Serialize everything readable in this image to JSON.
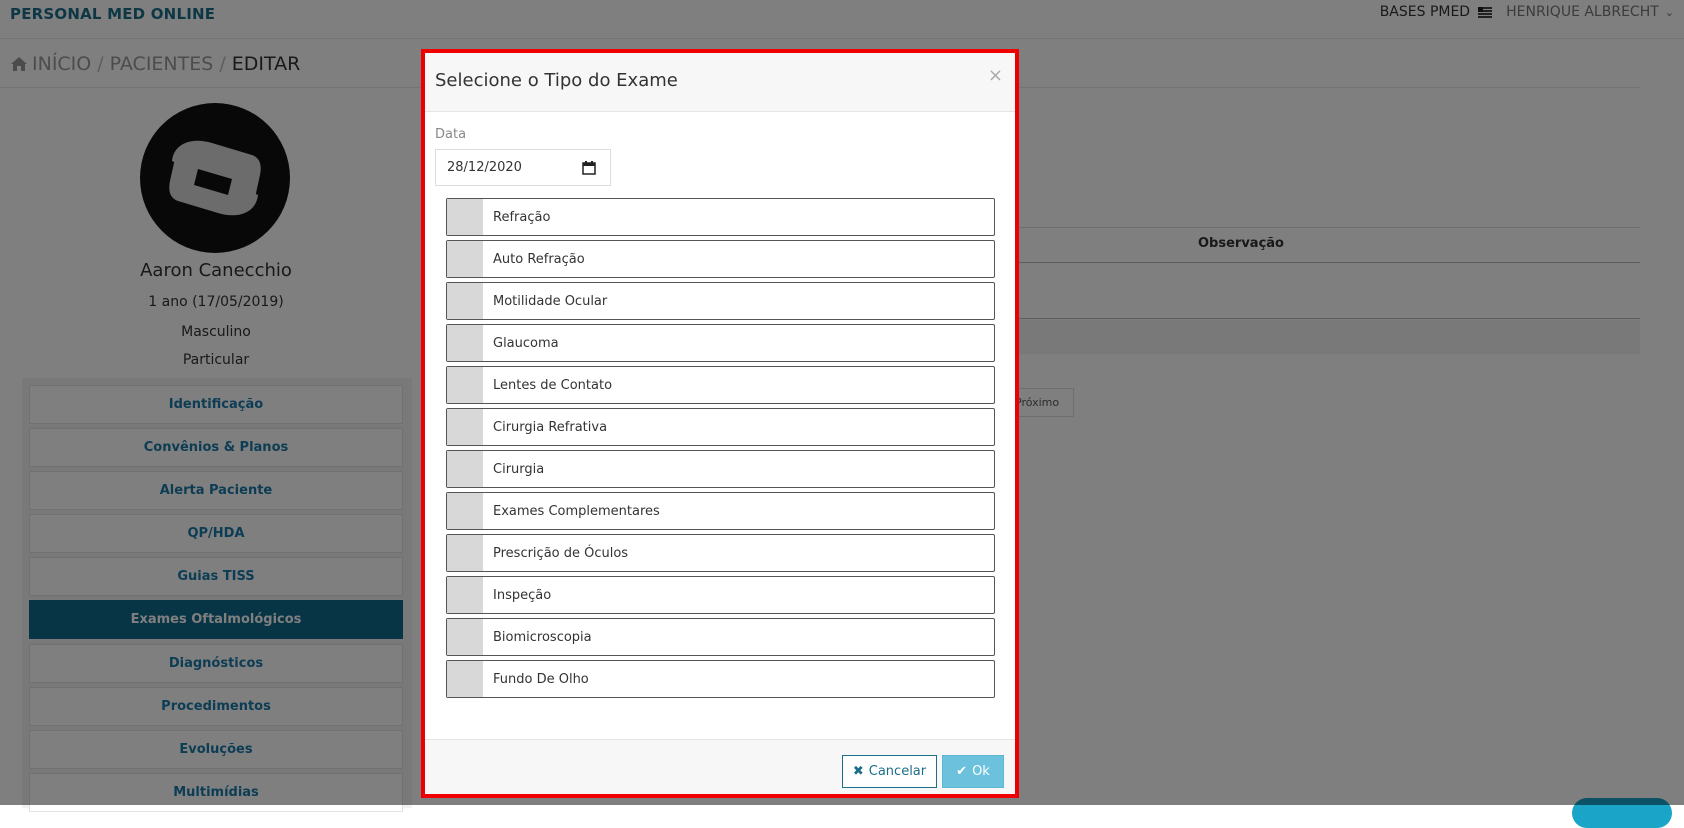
{
  "app": {
    "brand": "PERSONAL MED ONLINE",
    "bases_label": "BASES PMED",
    "user_name": "HENRIQUE ALBRECHT"
  },
  "breadcrumb": {
    "home": "INÍCIO",
    "sep": "/",
    "patients": "PACIENTES",
    "current": "EDITAR"
  },
  "patient": {
    "name": "Aaron Canecchio",
    "age": "1 ano (17/05/2019)",
    "gender": "Masculino",
    "plan": "Particular"
  },
  "sidebar": {
    "items": [
      {
        "label": "Identificação",
        "active": false
      },
      {
        "label": "Convênios & Planos",
        "active": false
      },
      {
        "label": "Alerta Paciente",
        "active": false
      },
      {
        "label": "QP/HDA",
        "active": false
      },
      {
        "label": "Guias TISS",
        "active": false
      },
      {
        "label": "Exames Oftalmológicos",
        "active": true
      },
      {
        "label": "Diagnósticos",
        "active": false
      },
      {
        "label": "Procedimentos",
        "active": false
      },
      {
        "label": "Evoluções",
        "active": false
      },
      {
        "label": "Multimídias",
        "active": false
      }
    ]
  },
  "content": {
    "column_observacao": "Observação",
    "pager_next": "Próximo"
  },
  "modal": {
    "title": "Selecione o Tipo do Exame",
    "close": "×",
    "date_label": "Data",
    "date_value": "28/12/2020",
    "exam_types": [
      "Refração",
      "Auto Refração",
      "Motilidade Ocular",
      "Glaucoma",
      "Lentes de Contato",
      "Cirurgia Refrativa",
      "Cirurgia",
      "Exames Complementares",
      "Prescrição de Óculos",
      "Inspeção",
      "Biomicroscopia",
      "Fundo De Olho"
    ],
    "cancel_label": "Cancelar",
    "ok_label": "Ok"
  },
  "colors": {
    "brand": "#1b6f8a",
    "menu_active": "#0f6b8c",
    "highlight_border": "#ee0000",
    "ok_button": "#6cc2dc"
  }
}
